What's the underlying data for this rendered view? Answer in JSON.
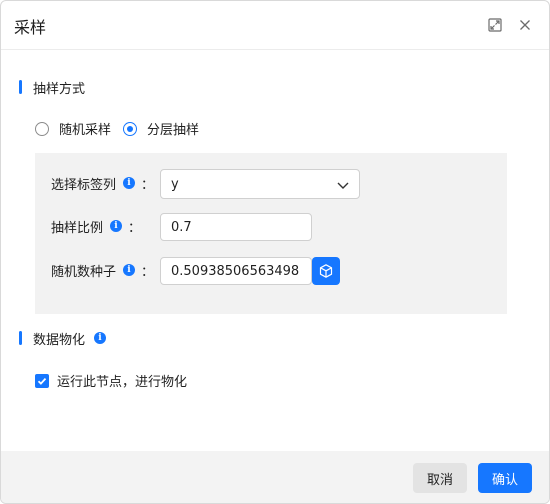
{
  "dialog": {
    "title": "采样",
    "expand_icon": "expand-icon",
    "close_icon": "close-icon"
  },
  "sampling": {
    "section_title": "抽样方式",
    "methods": [
      {
        "label": "随机采样",
        "checked": false
      },
      {
        "label": "分层抽样",
        "checked": true
      }
    ],
    "fields": {
      "label_column": {
        "label": "选择标签列",
        "value": "y",
        "colon": "："
      },
      "ratio": {
        "label": "抽样比例",
        "value": "0.7",
        "colon": "："
      },
      "seed": {
        "label": "随机数种子",
        "value": "0.50938506563498",
        "colon": "："
      }
    },
    "info_glyph": "i",
    "cube_icon": "cube-icon"
  },
  "materialize": {
    "section_title": "数据物化",
    "checkbox_label": "运行此节点，进行物化",
    "checked": true
  },
  "footer": {
    "cancel_label": "取消",
    "ok_label": "确认"
  },
  "colors": {
    "primary": "#1677ff",
    "panel_bg": "#f2f2f2",
    "footer_bg": "#f3f3f3"
  }
}
